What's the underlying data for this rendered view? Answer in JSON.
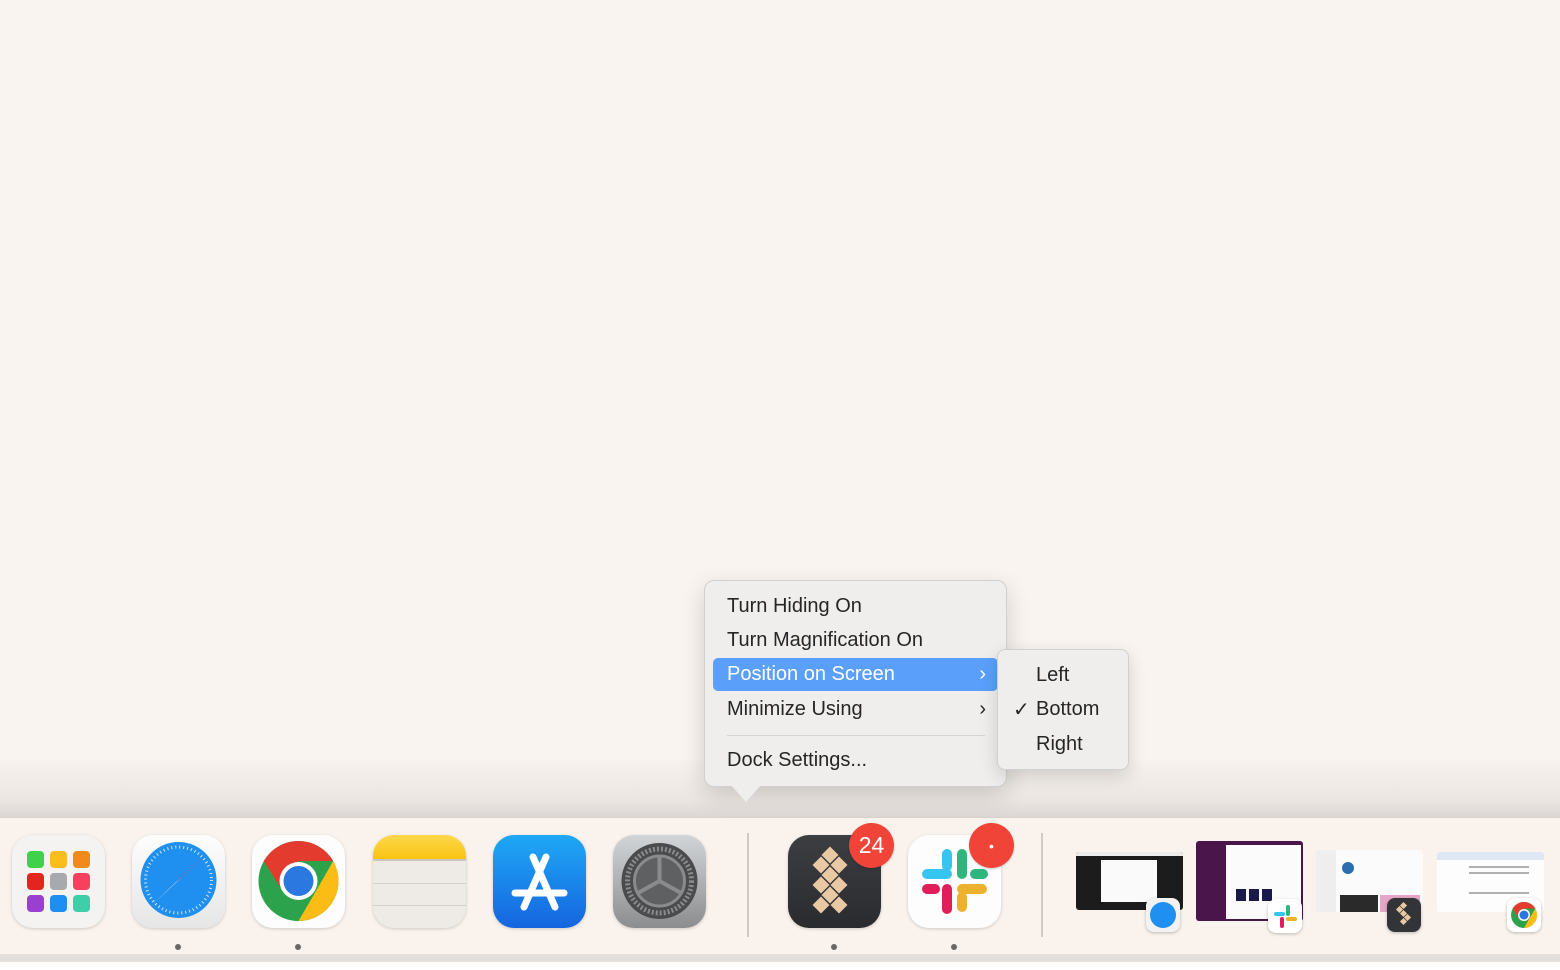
{
  "context_menu": {
    "items": [
      {
        "label": "Turn Hiding On",
        "has_submenu": false,
        "highlighted": false
      },
      {
        "label": "Turn Magnification On",
        "has_submenu": false,
        "highlighted": false
      },
      {
        "label": "Position on Screen",
        "has_submenu": true,
        "highlighted": true
      },
      {
        "label": "Minimize Using",
        "has_submenu": true,
        "highlighted": false
      },
      {
        "label": "Dock Settings...",
        "has_submenu": false,
        "highlighted": false
      }
    ],
    "chevron": "›",
    "highlight_color": "#5aa0fa"
  },
  "submenu": {
    "items": [
      {
        "label": "Left",
        "checked": false
      },
      {
        "label": "Bottom",
        "checked": true
      },
      {
        "label": "Right",
        "checked": false
      }
    ],
    "check_glyph": "✓"
  },
  "dock": {
    "apps": [
      {
        "name": "Launchpad",
        "icon": "launchpad-icon",
        "running": false
      },
      {
        "name": "Safari",
        "icon": "safari-icon",
        "running": true
      },
      {
        "name": "Google Chrome",
        "icon": "chrome-icon",
        "running": true
      },
      {
        "name": "Notes",
        "icon": "notes-icon",
        "running": false
      },
      {
        "name": "App Store",
        "icon": "app-store-icon",
        "running": false
      },
      {
        "name": "System Settings",
        "icon": "system-settings-icon",
        "running": false
      },
      {
        "name": "Setapp",
        "icon": "setapp-icon",
        "running": true,
        "badge": "24"
      },
      {
        "name": "Slack",
        "icon": "slack-icon",
        "running": true,
        "badge": "•"
      }
    ],
    "minimized_windows": [
      {
        "app": "Safari",
        "icon": "safari-icon"
      },
      {
        "app": "Slack",
        "icon": "slack-icon"
      },
      {
        "app": "Setapp",
        "icon": "setapp-icon"
      },
      {
        "app": "Google Chrome",
        "icon": "chrome-icon"
      }
    ],
    "badge_color": "#f04438"
  }
}
